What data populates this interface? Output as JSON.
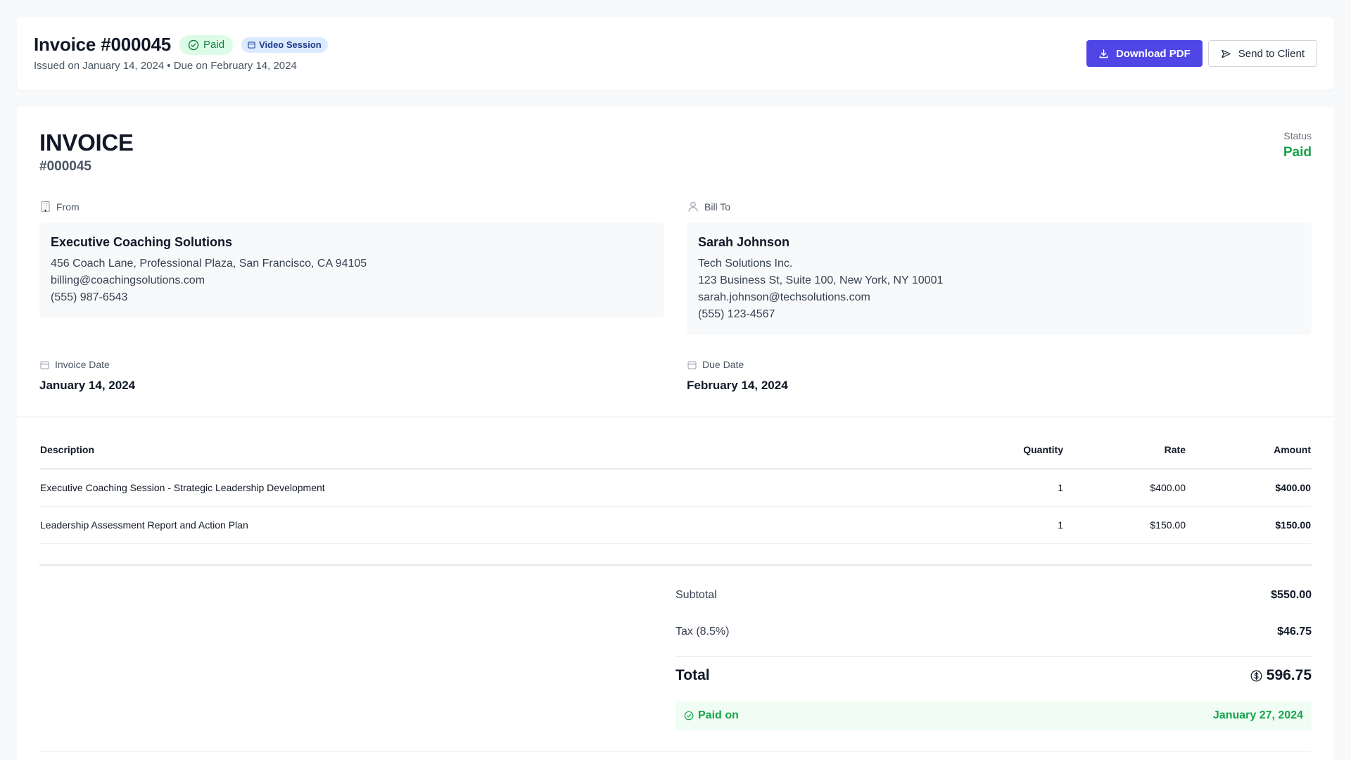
{
  "header": {
    "title": "Invoice #000045",
    "status_badge": "Paid",
    "type_badge": "Video Session",
    "subtitle": "Issued on January 14, 2024 • Due on February 14, 2024",
    "download_label": "Download PDF",
    "send_label": "Send to Client"
  },
  "invoice": {
    "heading": "INVOICE",
    "number": "#000045",
    "status_label": "Status",
    "status_value": "Paid"
  },
  "from": {
    "label": "From",
    "name": "Executive Coaching Solutions",
    "address": "456 Coach Lane, Professional Plaza, San Francisco, CA 94105",
    "email": "billing@coachingsolutions.com",
    "phone": "(555) 987-6543"
  },
  "bill_to": {
    "label": "Bill To",
    "name": "Sarah Johnson",
    "company": "Tech Solutions Inc.",
    "address": "123 Business St, Suite 100, New York, NY 10001",
    "email": "sarah.johnson@techsolutions.com",
    "phone": "(555) 123-4567"
  },
  "dates": {
    "invoice_label": "Invoice Date",
    "invoice_value": "January 14, 2024",
    "due_label": "Due Date",
    "due_value": "February 14, 2024"
  },
  "table": {
    "headers": {
      "description": "Description",
      "quantity": "Quantity",
      "rate": "Rate",
      "amount": "Amount"
    },
    "rows": [
      {
        "description": "Executive Coaching Session - Strategic Leadership Development",
        "quantity": "1",
        "rate": "$400.00",
        "amount": "$400.00"
      },
      {
        "description": "Leadership Assessment Report and Action Plan",
        "quantity": "1",
        "rate": "$150.00",
        "amount": "$150.00"
      }
    ]
  },
  "totals": {
    "subtotal_label": "Subtotal",
    "subtotal_value": "$550.00",
    "tax_label": "Tax (8.5%)",
    "tax_value": "$46.75",
    "total_label": "Total",
    "total_value": "596.75",
    "paid_label": "Paid on",
    "paid_value": "January 27, 2024"
  },
  "colors": {
    "primary": "#4f46e5",
    "paid_green": "#16a34a",
    "paid_bg": "#dcfce7",
    "video_bg": "#dbeafe"
  },
  "icons": {
    "paid_badge": "check-circle-icon",
    "video_badge": "calendar-icon",
    "download": "download-icon",
    "send": "send-icon",
    "from": "building-icon",
    "bill_to": "user-icon",
    "invoice_date": "calendar-icon",
    "due_date": "calendar-icon",
    "total": "dollar-circle-icon",
    "paid_on": "check-circle-icon"
  }
}
